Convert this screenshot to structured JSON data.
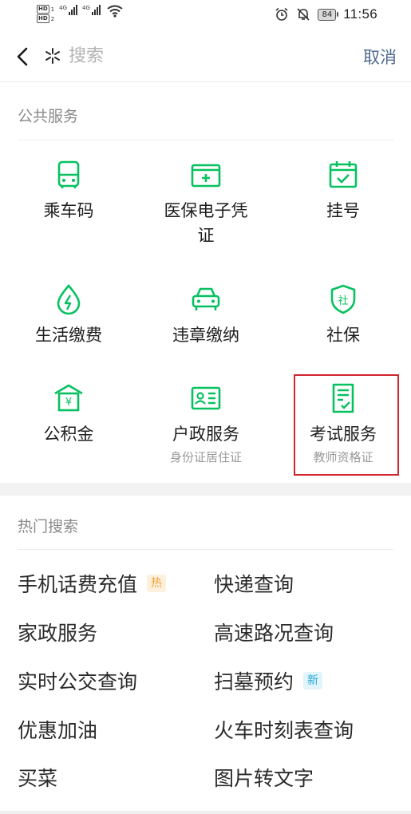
{
  "status_bar": {
    "hd_labels": [
      "HD",
      "HD"
    ],
    "hd_subs": [
      "1",
      "2"
    ],
    "network_labels": [
      "4G",
      "4G"
    ],
    "battery": "84",
    "time": "11:56"
  },
  "header": {
    "search_placeholder": "搜索",
    "cancel_label": "取消"
  },
  "public_services": {
    "title": "公共服务",
    "accent_color": "#07c160",
    "items": [
      {
        "label": "乘车码",
        "icon": "bus-icon"
      },
      {
        "label": "医保电子凭证",
        "icon": "medical-card-icon"
      },
      {
        "label": "挂号",
        "icon": "calendar-check-icon"
      },
      {
        "label": "生活缴费",
        "icon": "utility-drop-icon"
      },
      {
        "label": "违章缴纳",
        "icon": "car-icon"
      },
      {
        "label": "社保",
        "icon": "social-security-shield-icon"
      },
      {
        "label": "公积金",
        "icon": "housing-fund-icon"
      },
      {
        "label": "户政服务",
        "sub": "身份证居住证",
        "icon": "id-card-icon"
      },
      {
        "label": "考试服务",
        "sub": "教师资格证",
        "icon": "exam-document-icon"
      }
    ]
  },
  "hot_search": {
    "title": "热门搜索",
    "items": [
      {
        "label": "手机话费充值",
        "tag": "热"
      },
      {
        "label": "快递查询"
      },
      {
        "label": "家政服务"
      },
      {
        "label": "高速路况查询"
      },
      {
        "label": "实时公交查询"
      },
      {
        "label": "扫墓预约",
        "tag": "新"
      },
      {
        "label": "优惠加油"
      },
      {
        "label": "火车时刻表查询"
      },
      {
        "label": "买菜"
      },
      {
        "label": "图片转文字"
      }
    ]
  }
}
